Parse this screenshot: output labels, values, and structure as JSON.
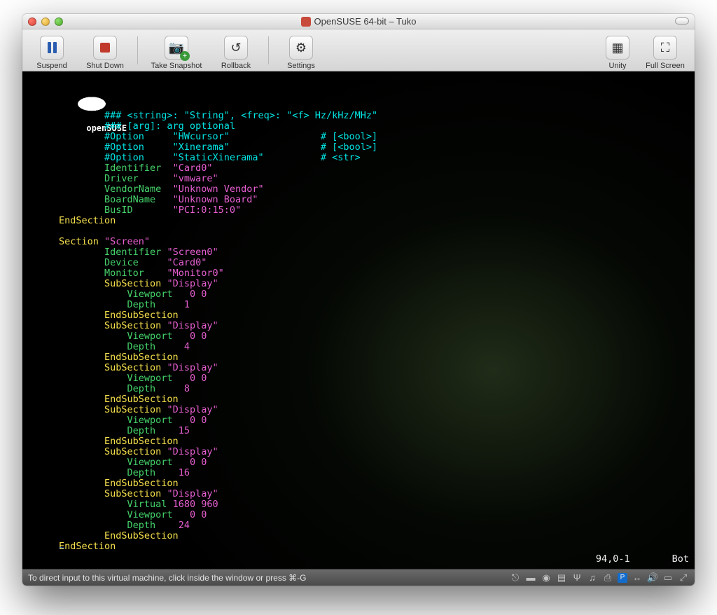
{
  "window": {
    "title": "OpenSUSE 64-bit – Tuko"
  },
  "toolbar": {
    "suspend": "Suspend",
    "shutdown": "Shut Down",
    "snapshot": "Take Snapshot",
    "rollback": "Rollback",
    "settings": "Settings",
    "unity": "Unity",
    "fullscreen": "Full Screen"
  },
  "logo_text": "openSUSE",
  "editor": {
    "lines": [
      [
        [
          "cy",
          "### <string>: \"String\", <freq>: \"<f> Hz/kHz/MHz\""
        ]
      ],
      [
        [
          "cy",
          "### [arg]: arg optional"
        ]
      ],
      [
        [
          "cy",
          "#Option     \"HWcursor\"                # [<bool>]"
        ]
      ],
      [
        [
          "cy",
          "#Option     \"Xinerama\"                # [<bool>]"
        ]
      ],
      [
        [
          "cy",
          "#Option     \"StaticXinerama\"          # <str>"
        ]
      ],
      [
        [
          "gr",
          "Identifier  "
        ],
        [
          "ma",
          "\"Card0\""
        ]
      ],
      [
        [
          "gr",
          "Driver      "
        ],
        [
          "ma",
          "\"vmware\""
        ]
      ],
      [
        [
          "gr",
          "VendorName  "
        ],
        [
          "ma",
          "\"Unknown Vendor\""
        ]
      ],
      [
        [
          "gr",
          "BoardName   "
        ],
        [
          "ma",
          "\"Unknown Board\""
        ]
      ],
      [
        [
          "gr",
          "BusID       "
        ],
        [
          "ma",
          "\"PCI:0:15:0\""
        ]
      ],
      [
        [
          "ye",
          "EndSection"
        ]
      ],
      [
        [
          "",
          ""
        ]
      ],
      [
        [
          "ye",
          "Section "
        ],
        [
          "ma",
          "\"Screen\""
        ]
      ],
      [
        [
          "gr",
          "Identifier "
        ],
        [
          "ma",
          "\"Screen0\""
        ]
      ],
      [
        [
          "gr",
          "Device     "
        ],
        [
          "ma",
          "\"Card0\""
        ]
      ],
      [
        [
          "gr",
          "Monitor    "
        ],
        [
          "ma",
          "\"Monitor0\""
        ]
      ],
      [
        [
          "ye",
          "SubSection "
        ],
        [
          "ma",
          "\"Display\""
        ]
      ],
      [
        [
          "gr",
          "    Viewport   "
        ],
        [
          "ma",
          "0 0"
        ]
      ],
      [
        [
          "gr",
          "    Depth     "
        ],
        [
          "ma",
          "1"
        ]
      ],
      [
        [
          "ye",
          "EndSubSection"
        ]
      ],
      [
        [
          "ye",
          "SubSection "
        ],
        [
          "ma",
          "\"Display\""
        ]
      ],
      [
        [
          "gr",
          "    Viewport   "
        ],
        [
          "ma",
          "0 0"
        ]
      ],
      [
        [
          "gr",
          "    Depth     "
        ],
        [
          "ma",
          "4"
        ]
      ],
      [
        [
          "ye",
          "EndSubSection"
        ]
      ],
      [
        [
          "ye",
          "SubSection "
        ],
        [
          "ma",
          "\"Display\""
        ]
      ],
      [
        [
          "gr",
          "    Viewport   "
        ],
        [
          "ma",
          "0 0"
        ]
      ],
      [
        [
          "gr",
          "    Depth     "
        ],
        [
          "ma",
          "8"
        ]
      ],
      [
        [
          "ye",
          "EndSubSection"
        ]
      ],
      [
        [
          "ye",
          "SubSection "
        ],
        [
          "ma",
          "\"Display\""
        ]
      ],
      [
        [
          "gr",
          "    Viewport   "
        ],
        [
          "ma",
          "0 0"
        ]
      ],
      [
        [
          "gr",
          "    Depth    "
        ],
        [
          "ma",
          "15"
        ]
      ],
      [
        [
          "ye",
          "EndSubSection"
        ]
      ],
      [
        [
          "ye",
          "SubSection "
        ],
        [
          "ma",
          "\"Display\""
        ]
      ],
      [
        [
          "gr",
          "    Viewport   "
        ],
        [
          "ma",
          "0 0"
        ]
      ],
      [
        [
          "gr",
          "    Depth    "
        ],
        [
          "ma",
          "16"
        ]
      ],
      [
        [
          "ye",
          "EndSubSection"
        ]
      ],
      [
        [
          "ye",
          "SubSection "
        ],
        [
          "ma",
          "\"Display\""
        ]
      ],
      [
        [
          "gr",
          "    Virtual "
        ],
        [
          "ma",
          "1680 960"
        ]
      ],
      [
        [
          "gr",
          "    Viewport   "
        ],
        [
          "ma",
          "0 0"
        ]
      ],
      [
        [
          "gr",
          "    Depth    "
        ],
        [
          "ma",
          "24"
        ]
      ],
      [
        [
          "ye",
          "EndSubSection"
        ]
      ],
      [
        [
          "ye",
          "EndSection"
        ]
      ]
    ],
    "outdent_keywords": [
      "EndSection",
      "Section "
    ],
    "base_indent": "        ",
    "cursor_pos": "94,0-1",
    "scroll_pos": "Bot",
    "tilde": "~"
  },
  "footer": {
    "hint": "To direct input to this virtual machine, click inside the window or press ⌘-G"
  }
}
